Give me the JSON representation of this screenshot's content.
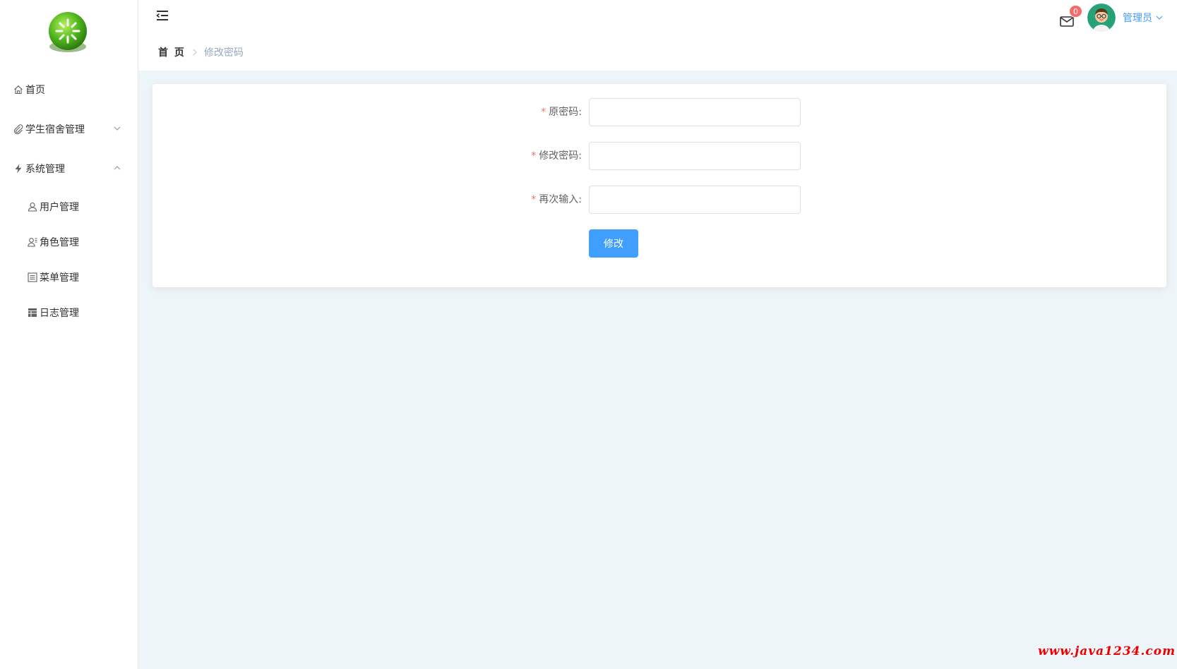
{
  "sidebar": {
    "items": [
      {
        "label": "首页",
        "icon": "home-icon"
      },
      {
        "label": "学生宿舍管理",
        "icon": "paperclip-icon",
        "expanded": false
      },
      {
        "label": "系统管理",
        "icon": "lightning-icon",
        "expanded": true
      },
      {
        "label": "用户管理",
        "icon": "user-icon"
      },
      {
        "label": "角色管理",
        "icon": "role-icon"
      },
      {
        "label": "菜单管理",
        "icon": "list-icon"
      },
      {
        "label": "日志管理",
        "icon": "table-icon"
      }
    ]
  },
  "header": {
    "breadcrumb": {
      "home": "首 页",
      "current": "修改密码"
    },
    "notification_count": "0",
    "username": "管理员"
  },
  "form": {
    "old_password_label": "原密码:",
    "new_password_label": "修改密码:",
    "confirm_password_label": "再次输入:",
    "old_password_value": "",
    "new_password_value": "",
    "confirm_password_value": "",
    "submit_label": "修改"
  },
  "watermark": "www.java1234.com",
  "colors": {
    "primary": "#409eff",
    "required": "#f56c6c",
    "background": "#eef5f8"
  }
}
